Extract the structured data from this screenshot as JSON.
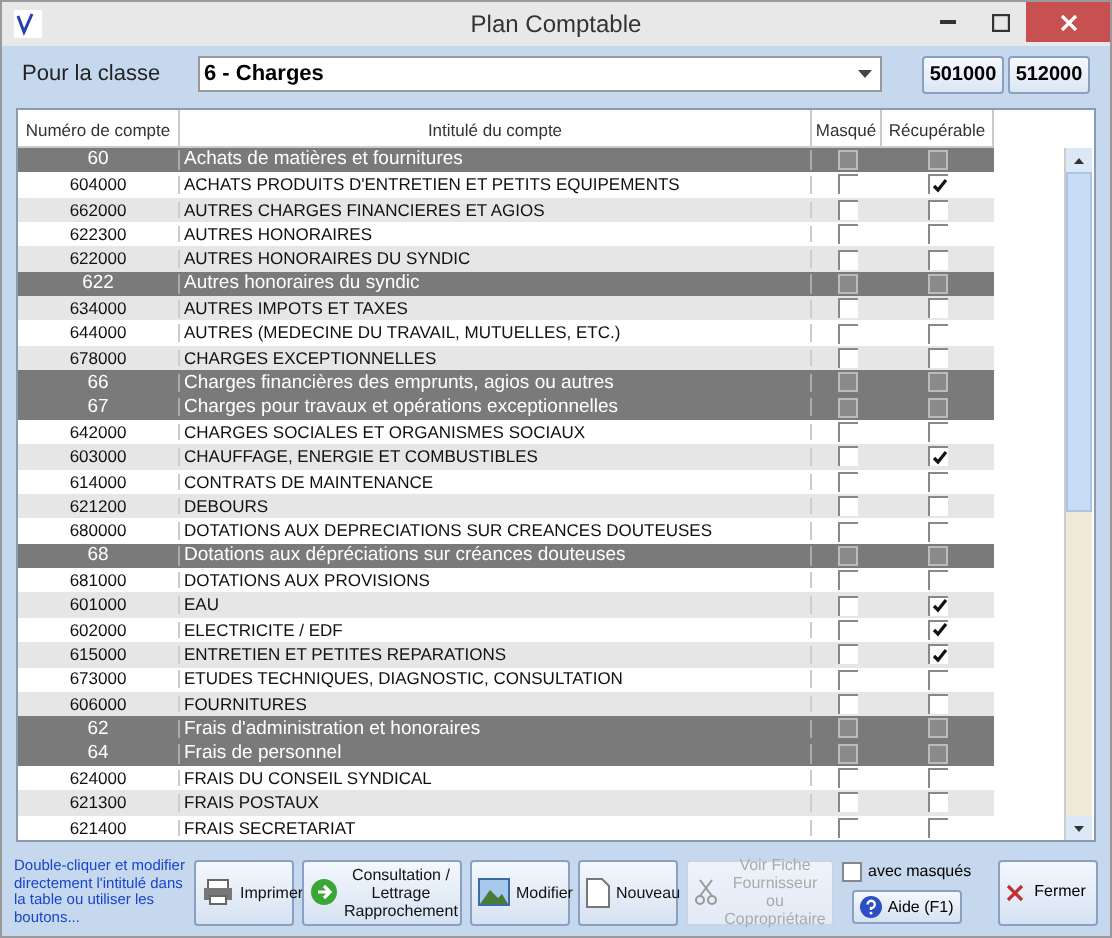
{
  "window": {
    "title": "Plan Comptable"
  },
  "class_label": "Pour la classe",
  "class_select": {
    "value": "6 - Charges"
  },
  "quick_buttons": [
    "501000",
    "512000"
  ],
  "table": {
    "columns": [
      "Numéro de compte",
      "Intitulé du compte",
      "Masqué",
      "Récupérable"
    ],
    "rows": [
      {
        "kind": "group",
        "number": "60",
        "label": "Achats de matières et fournitures",
        "masque": false,
        "recuperable": false
      },
      {
        "kind": "account",
        "number": "604000",
        "label": "ACHATS PRODUITS D'ENTRETIEN ET PETITS EQUIPEMENTS",
        "masque": false,
        "recuperable": true
      },
      {
        "kind": "account",
        "number": "662000",
        "label": "AUTRES CHARGES FINANCIERES ET AGIOS",
        "masque": false,
        "recuperable": false
      },
      {
        "kind": "account",
        "number": "622300",
        "label": "AUTRES HONORAIRES",
        "masque": false,
        "recuperable": false
      },
      {
        "kind": "account",
        "number": "622000",
        "label": "AUTRES HONORAIRES DU SYNDIC",
        "masque": false,
        "recuperable": false
      },
      {
        "kind": "group",
        "number": "622",
        "label": "Autres honoraires du syndic",
        "masque": false,
        "recuperable": false
      },
      {
        "kind": "account",
        "number": "634000",
        "label": "AUTRES IMPOTS ET TAXES",
        "masque": false,
        "recuperable": false
      },
      {
        "kind": "account",
        "number": "644000",
        "label": "AUTRES (MEDECINE DU TRAVAIL, MUTUELLES, ETC.)",
        "masque": false,
        "recuperable": false
      },
      {
        "kind": "account",
        "number": "678000",
        "label": "CHARGES EXCEPTIONNELLES",
        "masque": false,
        "recuperable": false
      },
      {
        "kind": "group",
        "number": "66",
        "label": "Charges financières des emprunts, agios ou autres",
        "masque": false,
        "recuperable": false
      },
      {
        "kind": "group",
        "number": "67",
        "label": "Charges pour travaux et opérations exceptionnelles",
        "masque": false,
        "recuperable": false
      },
      {
        "kind": "account",
        "number": "642000",
        "label": "CHARGES SOCIALES ET ORGANISMES SOCIAUX",
        "masque": false,
        "recuperable": false
      },
      {
        "kind": "account",
        "number": "603000",
        "label": "CHAUFFAGE, ENERGIE ET COMBUSTIBLES",
        "masque": false,
        "recuperable": true
      },
      {
        "kind": "account",
        "number": "614000",
        "label": "CONTRATS DE MAINTENANCE",
        "masque": false,
        "recuperable": false
      },
      {
        "kind": "account",
        "number": "621200",
        "label": "DEBOURS",
        "masque": false,
        "recuperable": false
      },
      {
        "kind": "account",
        "number": "680000",
        "label": "DOTATIONS AUX DEPRECIATIONS SUR CREANCES DOUTEUSES",
        "masque": false,
        "recuperable": false
      },
      {
        "kind": "group",
        "number": "68",
        "label": "Dotations aux dépréciations sur créances douteuses",
        "masque": false,
        "recuperable": false
      },
      {
        "kind": "account",
        "number": "681000",
        "label": "DOTATIONS AUX PROVISIONS",
        "masque": false,
        "recuperable": false
      },
      {
        "kind": "account",
        "number": "601000",
        "label": "EAU",
        "masque": false,
        "recuperable": true
      },
      {
        "kind": "account",
        "number": "602000",
        "label": "ELECTRICITE / EDF",
        "masque": false,
        "recuperable": true
      },
      {
        "kind": "account",
        "number": "615000",
        "label": "ENTRETIEN ET PETITES REPARATIONS",
        "masque": false,
        "recuperable": true
      },
      {
        "kind": "account",
        "number": "673000",
        "label": "ETUDES TECHNIQUES, DIAGNOSTIC, CONSULTATION",
        "masque": false,
        "recuperable": false
      },
      {
        "kind": "account",
        "number": "606000",
        "label": "FOURNITURES",
        "masque": false,
        "recuperable": false
      },
      {
        "kind": "group",
        "number": "62",
        "label": "Frais d'administration et honoraires",
        "masque": false,
        "recuperable": false
      },
      {
        "kind": "group",
        "number": "64",
        "label": "Frais de personnel",
        "masque": false,
        "recuperable": false
      },
      {
        "kind": "account",
        "number": "624000",
        "label": "FRAIS DU CONSEIL SYNDICAL",
        "masque": false,
        "recuperable": false
      },
      {
        "kind": "account",
        "number": "621300",
        "label": "FRAIS POSTAUX",
        "masque": false,
        "recuperable": false
      },
      {
        "kind": "account",
        "number": "621400",
        "label": "FRAIS SECRETARIAT",
        "masque": false,
        "recuperable": false
      }
    ]
  },
  "hint": "Double-cliquer et modifier directement l'intitulé dans la table ou utiliser les boutons...",
  "buttons": [
    {
      "kind": "print",
      "label": "Imprimer",
      "disabled": false
    },
    {
      "kind": "consult",
      "label": "Consultation / Lettrage Rapprochement",
      "disabled": false
    },
    {
      "kind": "edit",
      "label": "Modifier",
      "disabled": false
    },
    {
      "kind": "new",
      "label": "Nouveau",
      "disabled": false
    },
    {
      "kind": "supplier",
      "label": "Voir Fiche Fournisseur ou Copropriétaire",
      "disabled": true
    }
  ],
  "show_hidden": {
    "label": "avec masqués",
    "checked": false
  },
  "help_button": "Aide (F1)",
  "close_button": "Fermer"
}
